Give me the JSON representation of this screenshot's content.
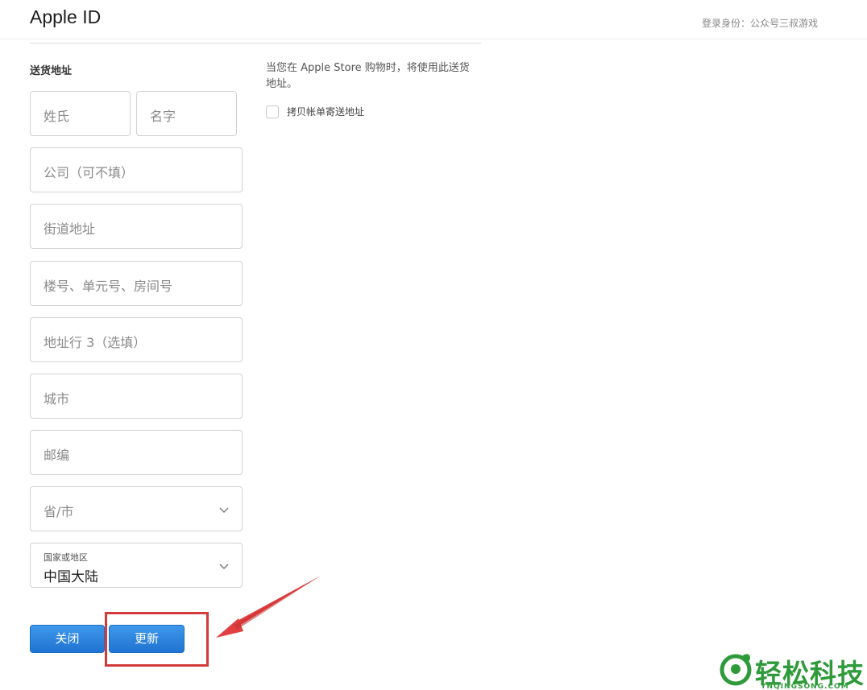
{
  "header": {
    "title": "Apple ID",
    "signed_in_text": "登录身份：公众号三叔游戏"
  },
  "shipping": {
    "section_title": "送货地址",
    "note": "当您在 Apple Store 购物时，将使用此送货地址。",
    "copy_billing_label": "拷贝帐单寄送地址",
    "copy_billing_checked": false,
    "fields": {
      "last_name": "姓氏",
      "first_name": "名字",
      "company": "公司（可不填）",
      "street": "街道地址",
      "building": "楼号、单元号、房间号",
      "address_line3": "地址行 3（选填）",
      "city": "城市",
      "postcode": "邮编",
      "province": "省/市",
      "country_label": "国家或地区",
      "country_value": "中国大陆"
    }
  },
  "buttons": {
    "close": "关闭",
    "update": "更新"
  },
  "colors": {
    "button_blue": "#1f73d1",
    "highlight_red": "#d33a3a",
    "watermark_green": "#2e9a3a"
  },
  "watermark": {
    "text": "轻松科技",
    "sub": "YNQINGSONG.COM"
  }
}
